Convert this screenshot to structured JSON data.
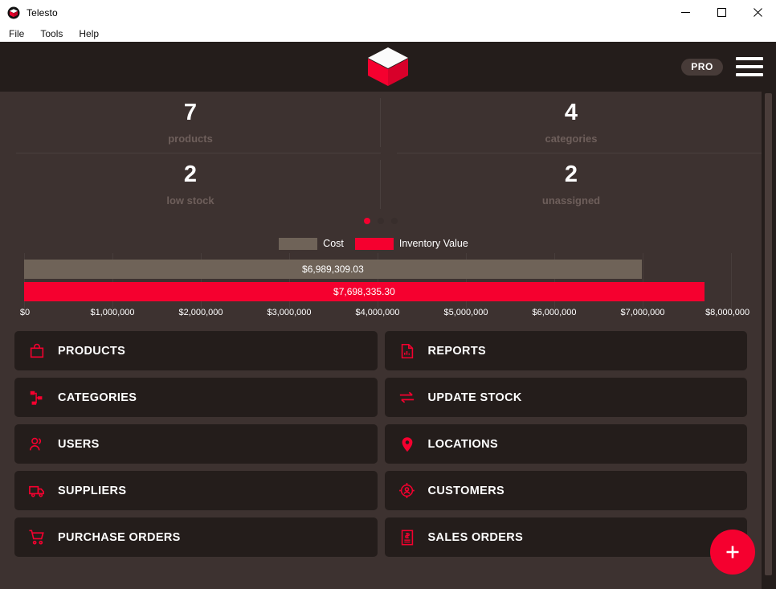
{
  "window": {
    "title": "Telesto",
    "app_icon": "cube-icon",
    "controls": {
      "minimize": "minimize-icon",
      "maximize": "maximize-icon",
      "close": "close-icon"
    }
  },
  "menubar": {
    "items": [
      {
        "label": "File"
      },
      {
        "label": "Tools"
      },
      {
        "label": "Help"
      }
    ]
  },
  "header": {
    "logo": "cube-logo-icon",
    "pro_badge": "PRO",
    "menu_icon": "hamburger-menu-icon"
  },
  "stats": {
    "cards": [
      {
        "value": "7",
        "label": "products"
      },
      {
        "value": "4",
        "label": "categories"
      },
      {
        "value": "2",
        "label": "low stock"
      },
      {
        "value": "2",
        "label": "unassigned"
      }
    ],
    "pager": {
      "count": 3,
      "active_index": 0
    }
  },
  "chart_data": {
    "type": "bar",
    "orientation": "horizontal",
    "title": "",
    "xlabel": "",
    "ylabel": "",
    "categories": [
      "Cost",
      "Inventory Value"
    ],
    "values": [
      6989309.03,
      7698335.3
    ],
    "value_labels": [
      "$6,989,309.03",
      "$7,698,335.30"
    ],
    "colors": [
      "#6f6358",
      "#f5002f"
    ],
    "legend": [
      {
        "name": "Cost",
        "color": "#6f6358"
      },
      {
        "name": "Inventory Value",
        "color": "#f5002f"
      }
    ],
    "legend_position": "top-center",
    "grid": true,
    "xlim": [
      0,
      8000000
    ],
    "xticks": [
      0,
      1000000,
      2000000,
      3000000,
      4000000,
      5000000,
      6000000,
      7000000,
      8000000
    ],
    "xticklabels": [
      "$0",
      "$1,000,000",
      "$2,000,000",
      "$3,000,000",
      "$4,000,000",
      "$5,000,000",
      "$6,000,000",
      "$7,000,000",
      "$8,000,000"
    ]
  },
  "tiles": [
    {
      "label": "PRODUCTS",
      "icon": "shopping-bag-icon"
    },
    {
      "label": "REPORTS",
      "icon": "report-document-icon"
    },
    {
      "label": "CATEGORIES",
      "icon": "category-tree-icon"
    },
    {
      "label": "UPDATE STOCK",
      "icon": "exchange-arrows-icon"
    },
    {
      "label": "USERS",
      "icon": "users-icon"
    },
    {
      "label": "LOCATIONS",
      "icon": "map-pin-icon"
    },
    {
      "label": "SUPPLIERS",
      "icon": "truck-icon"
    },
    {
      "label": "CUSTOMERS",
      "icon": "customer-target-icon"
    },
    {
      "label": "PURCHASE ORDERS",
      "icon": "shopping-cart-icon"
    },
    {
      "label": "SALES ORDERS",
      "icon": "invoice-dollar-icon"
    }
  ],
  "fab": {
    "icon": "plus-icon",
    "label": "+"
  },
  "theme": {
    "accent": "#f5002f",
    "page_bg": "#3d3230",
    "tile_bg": "#241d1b",
    "header_bg": "#241d1b",
    "muted_text": "#6e5f5b"
  }
}
